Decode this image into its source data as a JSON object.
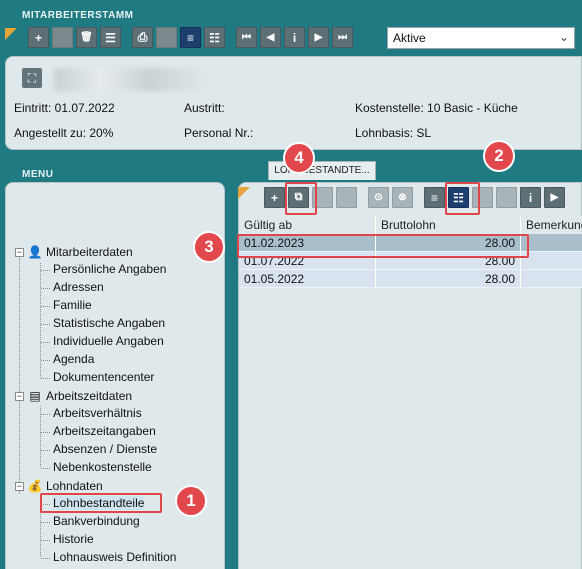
{
  "header": {
    "title": "MITARBEITERSTAMM"
  },
  "top_toolbar": {
    "buttons": [
      {
        "name": "add-icon",
        "glyph": "+"
      },
      {
        "name": "blank-icon",
        "glyph": ""
      },
      {
        "name": "trash-icon",
        "glyph": "🗑"
      },
      {
        "name": "list-filter-icon",
        "glyph": "☰"
      },
      {
        "name": "print-icon",
        "glyph": "⎙"
      },
      {
        "name": "blank-icon",
        "glyph": ""
      },
      {
        "name": "align-left-icon",
        "glyph": "≡"
      },
      {
        "name": "list-icon",
        "glyph": "☷"
      },
      {
        "name": "first-record-icon",
        "glyph": "⏮"
      },
      {
        "name": "previous-record-icon",
        "glyph": "◀"
      },
      {
        "name": "info-icon",
        "glyph": "i"
      },
      {
        "name": "next-record-icon",
        "glyph": "▶"
      },
      {
        "name": "last-record-icon",
        "glyph": "⏭"
      }
    ],
    "filter_value": "Aktive"
  },
  "employee": {
    "eintritt": "Eintritt: 01.07.2022",
    "austritt": "Austritt:",
    "kostenstelle": "Kostenstelle: 10 Basic - Küche",
    "angestellt": "Angestellt zu: 20%",
    "personal_nr": "Personal Nr.:",
    "lohnbasis": "Lohnbasis: SL"
  },
  "menu": {
    "title": "MENU",
    "groups": [
      {
        "label": "Mitarbeiterdaten",
        "icon": "person-icon",
        "items": [
          "Persönliche Angaben",
          "Adressen",
          "Familie",
          "Statistische Angaben",
          "Individuelle Angaben",
          "Agenda",
          "Dokumentencenter"
        ]
      },
      {
        "label": "Arbeitszeitdaten",
        "icon": "calendar-icon",
        "items": [
          "Arbeitsverhältnis",
          "Arbeitszeitangaben",
          "Absenzen / Dienste",
          "Nebenkostenstelle"
        ]
      },
      {
        "label": "Lohndaten",
        "icon": "money-icon",
        "items": [
          "Lohnbestandteile",
          "Bankverbindung",
          "Historie",
          "Lohnausweis Definition"
        ]
      }
    ]
  },
  "content": {
    "tab_label": "LOHNBESTANDTE...",
    "columns": [
      "Gültig ab",
      "Bruttolohn",
      "Bemerkung"
    ],
    "rows": [
      {
        "date": "01.02.2023",
        "amount": "28.00",
        "remark": ""
      },
      {
        "date": "01.07.2022",
        "amount": "28.00",
        "remark": ""
      },
      {
        "date": "01.05.2022",
        "amount": "28.00",
        "remark": ""
      }
    ]
  },
  "annotations": {
    "badge1": "1",
    "badge2": "2",
    "badge3": "3",
    "badge4": "4"
  }
}
